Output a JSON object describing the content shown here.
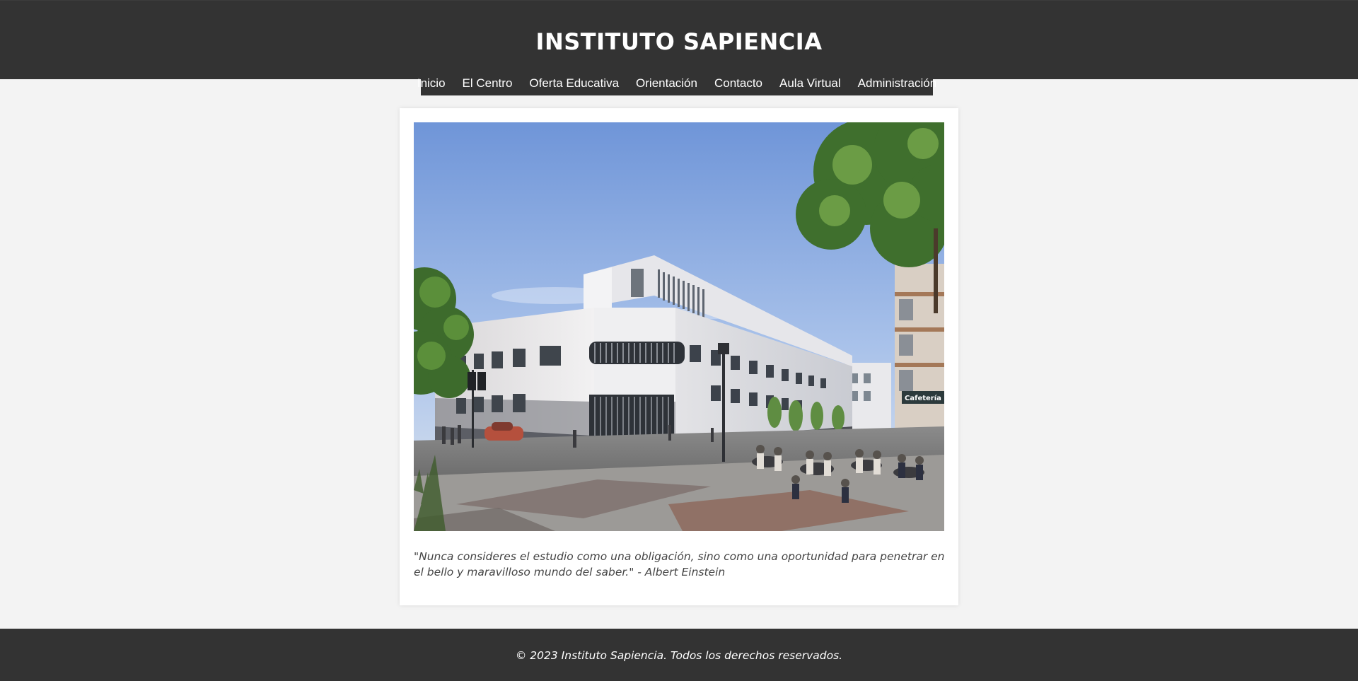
{
  "header": {
    "title": "INSTITUTO SAPIENCIA"
  },
  "nav": {
    "items": [
      {
        "label": "Inicio"
      },
      {
        "label": "El Centro"
      },
      {
        "label": "Oferta Educativa"
      },
      {
        "label": "Orientación"
      },
      {
        "label": "Contacto"
      },
      {
        "label": "Aula Virtual"
      },
      {
        "label": "Administración"
      }
    ]
  },
  "main": {
    "image_icon": "school-building-photo",
    "image_sign_text": "Cafetería",
    "quote": "\"Nunca consideres el estudio como una obligación, sino como una oportunidad para penetrar en el bello y maravilloso mundo del saber.\" - Albert Einstein"
  },
  "footer": {
    "text": "© 2023 Instituto Sapiencia. Todos los derechos reservados."
  },
  "colors": {
    "header_bg": "#333333",
    "page_bg": "#f3f3f3",
    "card_bg": "#ffffff",
    "footer_bg": "#333333",
    "quote_text": "#444444"
  }
}
